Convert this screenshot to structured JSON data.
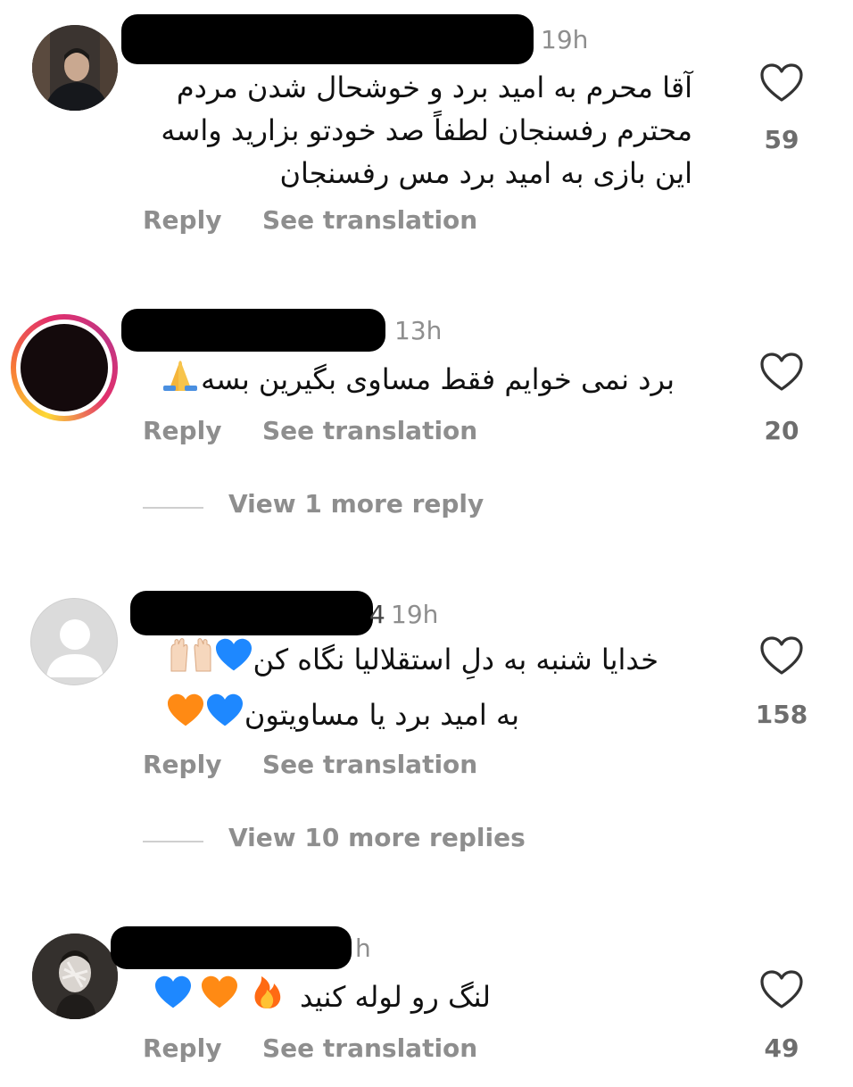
{
  "comments": [
    {
      "time": "19h",
      "text_lines": [
        "آقا محرم به امید برد و خوشحال شدن مردم",
        "محترم رفسنجان لطفاً صد خودتو بزارید واسه",
        "این بازی به امید برد مس رفسنجان"
      ],
      "likes": "59",
      "reply": "Reply",
      "translate": "See translation"
    },
    {
      "time": "13h",
      "text": "برد نمی خوایم فقط مساوی بگیرین بسه",
      "emoji_icon": "folded-hands-icon",
      "likes": "20",
      "reply": "Reply",
      "translate": "See translation",
      "view_more": "View 1 more reply"
    },
    {
      "time": "19h",
      "time_prefix": "4",
      "line1": "خدایا شنبه به دلِ استقلالیا نگاه کن",
      "line2": "به امید برد یا مساویتون",
      "likes": "158",
      "reply": "Reply",
      "translate": "See translation",
      "view_more": "View 10 more replies"
    },
    {
      "time": "h",
      "text": "لنگ رو لوله کنید",
      "likes": "49",
      "reply": "Reply",
      "translate": "See translation"
    }
  ],
  "colors": {
    "blue_heart": "#1e88ff",
    "orange_heart": "#ff8a14",
    "story_ring_start": "#fdd835",
    "story_ring_end": "#e1306c",
    "meta_gray": "#8e8e8e"
  }
}
